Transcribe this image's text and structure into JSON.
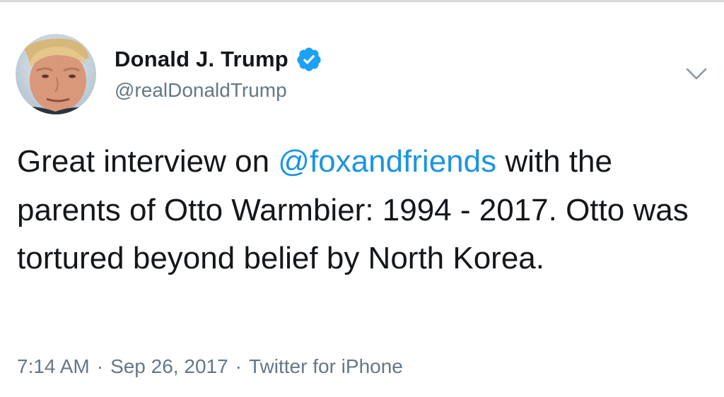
{
  "user": {
    "display_name": "Donald J. Trump",
    "handle": "@realDonaldTrump",
    "verified": true,
    "verified_color": "#1da1f2"
  },
  "tweet": {
    "text_before": "Great interview on ",
    "mention": "@foxandfriends",
    "text_after": " with the parents of Otto Warmbier: 1994 - 2017. Otto was tortured beyond belief by North Korea.",
    "mention_color": "#1b95e0"
  },
  "meta": {
    "time": "7:14 AM",
    "separator": "·",
    "date": "Sep 26, 2017",
    "source": "Twitter for iPhone"
  },
  "icons": {
    "avatar": "profile-photo",
    "verified": "verified-badge-icon",
    "menu": "chevron-down-icon"
  }
}
